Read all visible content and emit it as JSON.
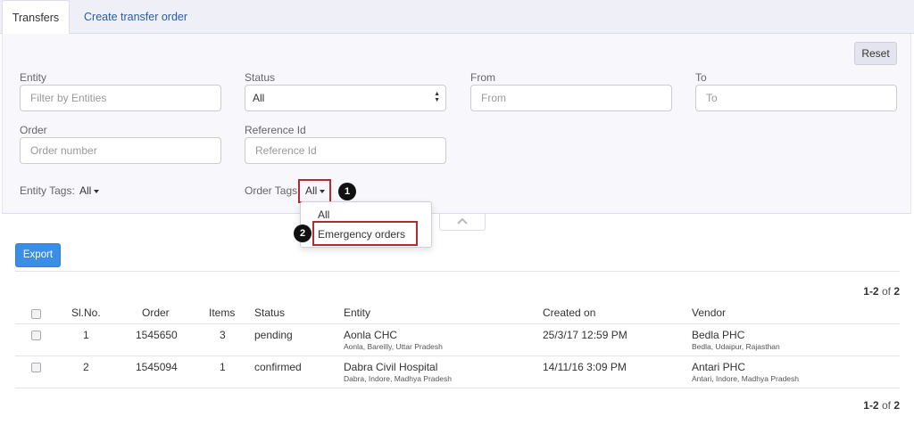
{
  "tabs": [
    {
      "label": "Transfers",
      "active": true
    },
    {
      "label": "Create transfer order",
      "active": false
    }
  ],
  "filters": {
    "reset_label": "Reset",
    "entity": {
      "label": "Entity",
      "placeholder": "Filter by Entities"
    },
    "status": {
      "label": "Status",
      "value": "All"
    },
    "from": {
      "label": "From",
      "placeholder": "From"
    },
    "to": {
      "label": "To",
      "placeholder": "To"
    },
    "order": {
      "label": "Order",
      "placeholder": "Order number"
    },
    "reference": {
      "label": "Reference Id",
      "placeholder": "Reference Id"
    },
    "entity_tags": {
      "label": "Entity Tags:",
      "value": "All"
    },
    "order_tags": {
      "label": "Order Tags",
      "value": "All"
    }
  },
  "order_tags_dropdown": {
    "options": [
      "All",
      "Emergency orders"
    ]
  },
  "annotations": {
    "step1": "1",
    "step2": "2",
    "highlight_color": "#b22a33"
  },
  "export_label": "Export",
  "pagination": {
    "range": "1-2",
    "of_text": "of",
    "total": "2"
  },
  "table": {
    "columns": [
      "Sl.No.",
      "Order",
      "Items",
      "Status",
      "Entity",
      "Created on",
      "Vendor"
    ],
    "rows": [
      {
        "sl": "1",
        "order": "1545650",
        "items": "3",
        "status": "pending",
        "entity": "Aonla CHC",
        "entity_sub": "Aonla, Bareilly, Uttar Pradesh",
        "created": "25/3/17 12:59 PM",
        "vendor": "Bedla PHC",
        "vendor_sub": "Bedla, Udaipur, Rajasthan"
      },
      {
        "sl": "2",
        "order": "1545094",
        "items": "1",
        "status": "confirmed",
        "entity": "Dabra Civil Hospital",
        "entity_sub": "Dabra, Indore, Madhya Pradesh",
        "created": "14/11/16 3:09 PM",
        "vendor": "Antari PHC",
        "vendor_sub": "Antari, Indore, Madhya Pradesh"
      }
    ]
  },
  "colors": {
    "accent": "#3a8ee6",
    "link": "#2a5c9e",
    "panel_bg": "#f7f7fc"
  }
}
